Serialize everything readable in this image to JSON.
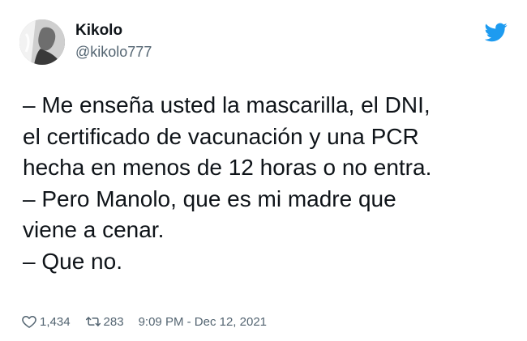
{
  "author": {
    "display_name": "Kikolo",
    "handle": "@kikolo777"
  },
  "tweet": {
    "lines": [
      "– Me enseña usted la mascarilla, el DNI,",
      "el certificado de vacunación y una PCR",
      "hecha en menos de 12 horas o no entra.",
      "– Pero Manolo, que es mi madre que",
      "viene a cenar.",
      "– Que no."
    ]
  },
  "meta": {
    "likes": "1,434",
    "retweets": "283",
    "timestamp": "9:09 PM - Dec 12, 2021"
  },
  "icons": {
    "brand": "twitter-bird-icon",
    "like": "heart-icon",
    "retweet": "retweet-icon"
  },
  "colors": {
    "brand_blue": "#1d9bf0",
    "text": "#0f1419",
    "secondary_text": "#536471"
  }
}
